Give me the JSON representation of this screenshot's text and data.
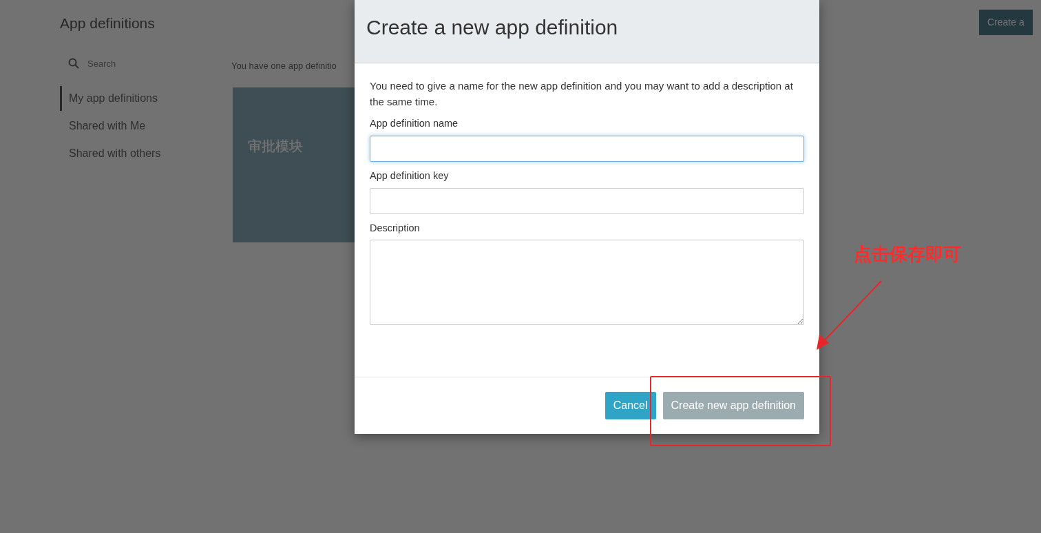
{
  "page": {
    "title": "App definitions",
    "create_button": "Create a",
    "search": {
      "placeholder": "Search"
    },
    "summary": "You have one app definitio",
    "filters": [
      {
        "label": "My app definitions",
        "selected": true
      },
      {
        "label": "Shared with Me",
        "selected": false
      },
      {
        "label": "Shared with others",
        "selected": false
      }
    ],
    "cards": [
      {
        "name": "审批模块"
      }
    ]
  },
  "dialog": {
    "title": "Create a new app definition",
    "intro": "You need to give a name for the new app definition and you may want to add a description at the same time.",
    "fields": [
      {
        "label": "App definition name",
        "kind": "input",
        "focused": true
      },
      {
        "label": "App definition key",
        "kind": "input",
        "focused": false
      },
      {
        "label": "Description",
        "kind": "textarea",
        "focused": false
      }
    ],
    "buttons": [
      {
        "label": "Cancel",
        "kind": "cancel",
        "disabled": false
      },
      {
        "label": "Create new app definition",
        "kind": "primary",
        "disabled": true
      }
    ]
  },
  "annotation": {
    "text": "点击保存即可"
  }
}
